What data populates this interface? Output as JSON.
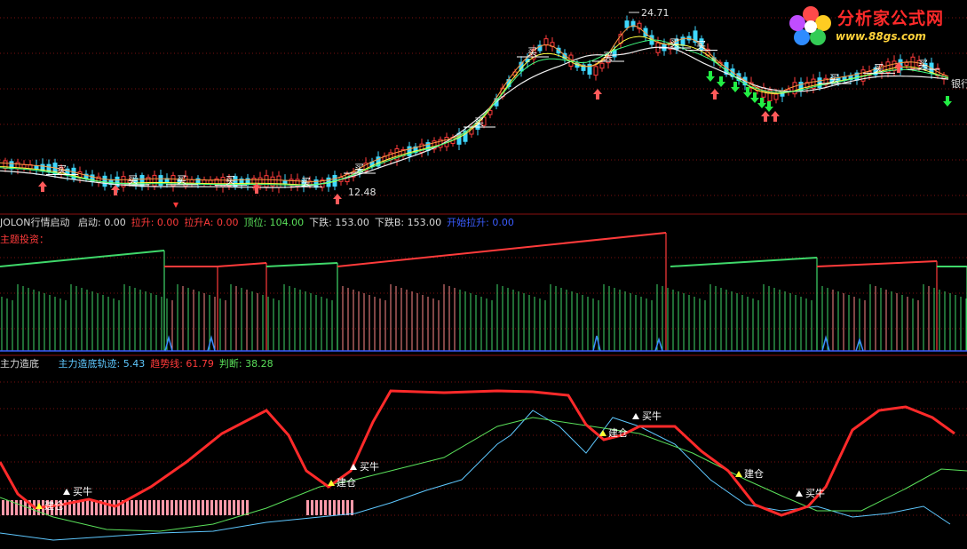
{
  "panel1": {
    "peak_label": "24.71",
    "low_label": "12.48",
    "buy_mark": "买",
    "side_label": "银行"
  },
  "panel2": {
    "title": "JOLON行情启动",
    "items": [
      {
        "label": "启动: 0.00",
        "color": "#d8d8d8"
      },
      {
        "label": "拉升: 0.00",
        "color": "#ff3b3b"
      },
      {
        "label": "拉升A: 0.00",
        "color": "#ff3b3b"
      },
      {
        "label": "顶位: 104.00",
        "color": "#5ae05a"
      },
      {
        "label": "下跌: 153.00",
        "color": "#d8d8d8"
      },
      {
        "label": "下跌B: 153.00",
        "color": "#d8d8d8"
      },
      {
        "label": "开始拉升: 0.00",
        "color": "#3a5cff"
      }
    ],
    "sub_label": "主题投资："
  },
  "panel3": {
    "title": "主力造底",
    "items": [
      {
        "label": "主力造底轨迹: 5.43",
        "color": "#5ec8ff"
      },
      {
        "label": "趋势线: 61.79",
        "color": "#ff3b3b"
      },
      {
        "label": "判断: 38.28",
        "color": "#5ae05a"
      }
    ],
    "buy_label": "买牛",
    "build_label": "建仓"
  },
  "logo": {
    "title": "分析家公式网",
    "url": "www.88gs.com"
  }
}
